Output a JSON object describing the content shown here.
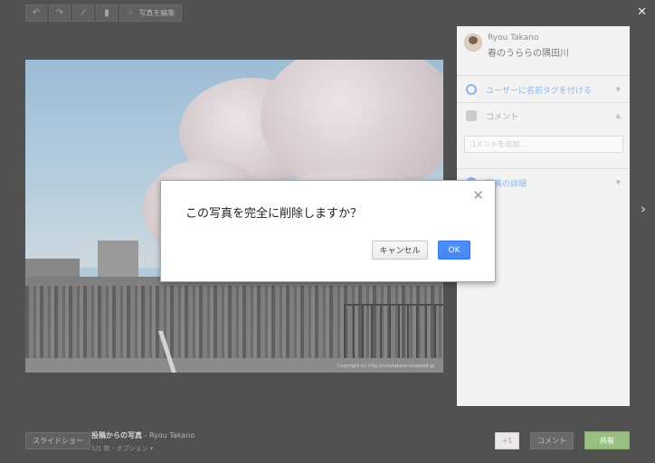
{
  "toolbar": {
    "edit_label": "写真を編集"
  },
  "side_panel": {
    "owner_name": "Ryou Takano",
    "photo_title": "春のうららの隅田川",
    "tag_label": "ユーザーに名前タグを付ける",
    "comments_label": "コメント",
    "comment_placeholder": "コメントを追加...",
    "details_label": "写真の詳細"
  },
  "photo": {
    "watermark": "Copyright (c) http://ryoutakano.blogspot.jp"
  },
  "bottom_bar": {
    "slideshow_label": "スライドショー",
    "album_title": "投稿からの写真",
    "separator": "-",
    "author": "Ryou Takano",
    "position": "1/1 枚",
    "options_label": "オプション",
    "plus_label": "+1",
    "comment_label": "コメント",
    "share_label": "共有"
  },
  "dialog": {
    "message": "この写真を完全に削除しますか？",
    "cancel_label": "キャンセル",
    "ok_label": "OK"
  }
}
